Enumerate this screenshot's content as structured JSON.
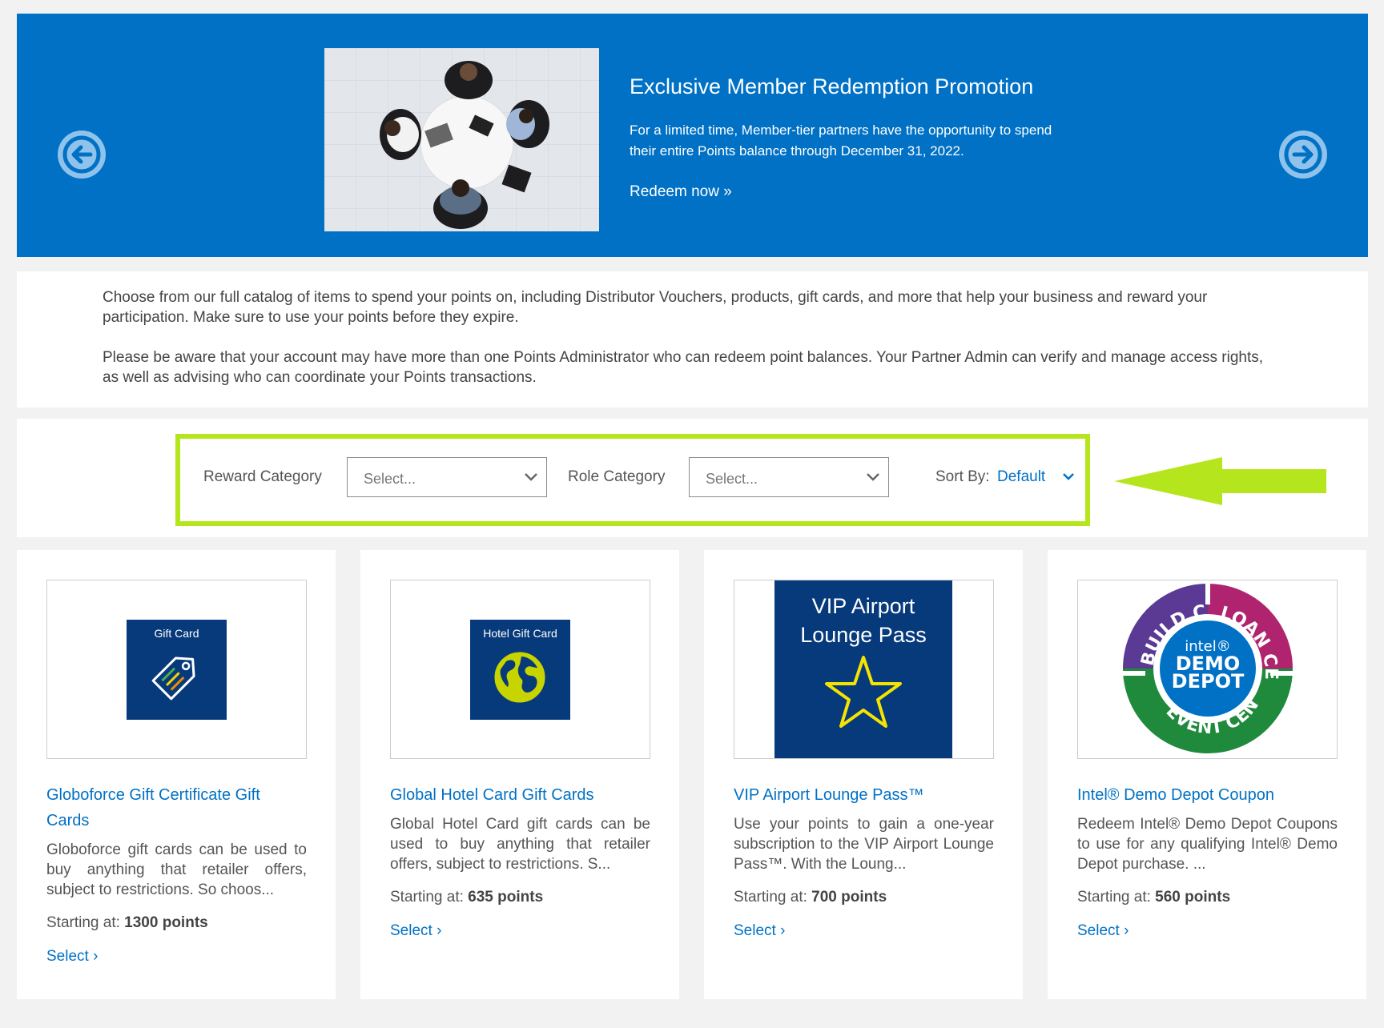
{
  "banner": {
    "title": "Exclusive Member Redemption Promotion",
    "text": "For a limited time, Member-tier partners have the opportunity to spend their entire Points balance through December 31, 2022.",
    "link": "Redeem now »",
    "prev_icon": "arrow-left-icon",
    "next_icon": "arrow-right-icon",
    "colors": {
      "background": "#0071c5",
      "nav": "#8fc3ec"
    }
  },
  "intro": {
    "p1": "Choose from our full catalog of items to spend your points on, including Distributor Vouchers, products, gift cards, and more that help your business and reward your participation. Make sure to use your points before they expire.",
    "p2": "Please be aware that your account may have more than one Points Administrator who can redeem point balances. Your Partner Admin can verify and manage access rights, as well as advising who can coordinate your Points transactions."
  },
  "filters": {
    "reward_label": "Reward Category",
    "reward_placeholder": "Select...",
    "role_label": "Role Category",
    "role_placeholder": "Select...",
    "sort_label": "Sort By:",
    "sort_value": "Default",
    "highlight_color": "#b5e61d"
  },
  "cards": [
    {
      "title": "Globoforce Gift Certificate Gift Cards",
      "desc": "Globoforce gift cards can be used to buy anything that retailer offers, subject to restrictions. So choos...",
      "points_label": "Starting at:",
      "points": "1300 points",
      "select": "Select ›",
      "tile_label": "Gift Card",
      "icon": "tag-icon"
    },
    {
      "title": "Global Hotel Card Gift Cards",
      "desc": "Global Hotel Card gift cards can be used to buy anything that retailer offers, subject to restrictions. S...",
      "points_label": "Starting at:",
      "points": "635 points",
      "select": "Select ›",
      "tile_label": "Hotel Gift Card",
      "icon": "globe-icon"
    },
    {
      "title": "VIP Airport Lounge Pass™",
      "desc": "Use your points to gain a one-year subscription to the VIP Airport Lounge Pass™. With the Loung...",
      "points_label": "Starting at:",
      "points": "700 points",
      "select": "Select ›",
      "tile_line1": "VIP Airport",
      "tile_line2": "Lounge Pass",
      "icon": "star-icon"
    },
    {
      "title": "Intel® Demo Depot Coupon",
      "desc": "Redeem Intel® Demo Depot Coupons to use for any qualifying Intel® Demo Depot purchase. ...",
      "points_label": "Starting at:",
      "points": "560 points",
      "select": "Select ›",
      "logo_top_left": "BUILD CENTER",
      "logo_top_right": "LOAN CENTER",
      "logo_bottom": "EVENT CENTER",
      "logo_intel": "intel®",
      "logo_demo": "DEMO",
      "logo_depot": "DEPOT",
      "icon": "demo-depot-logo"
    }
  ]
}
